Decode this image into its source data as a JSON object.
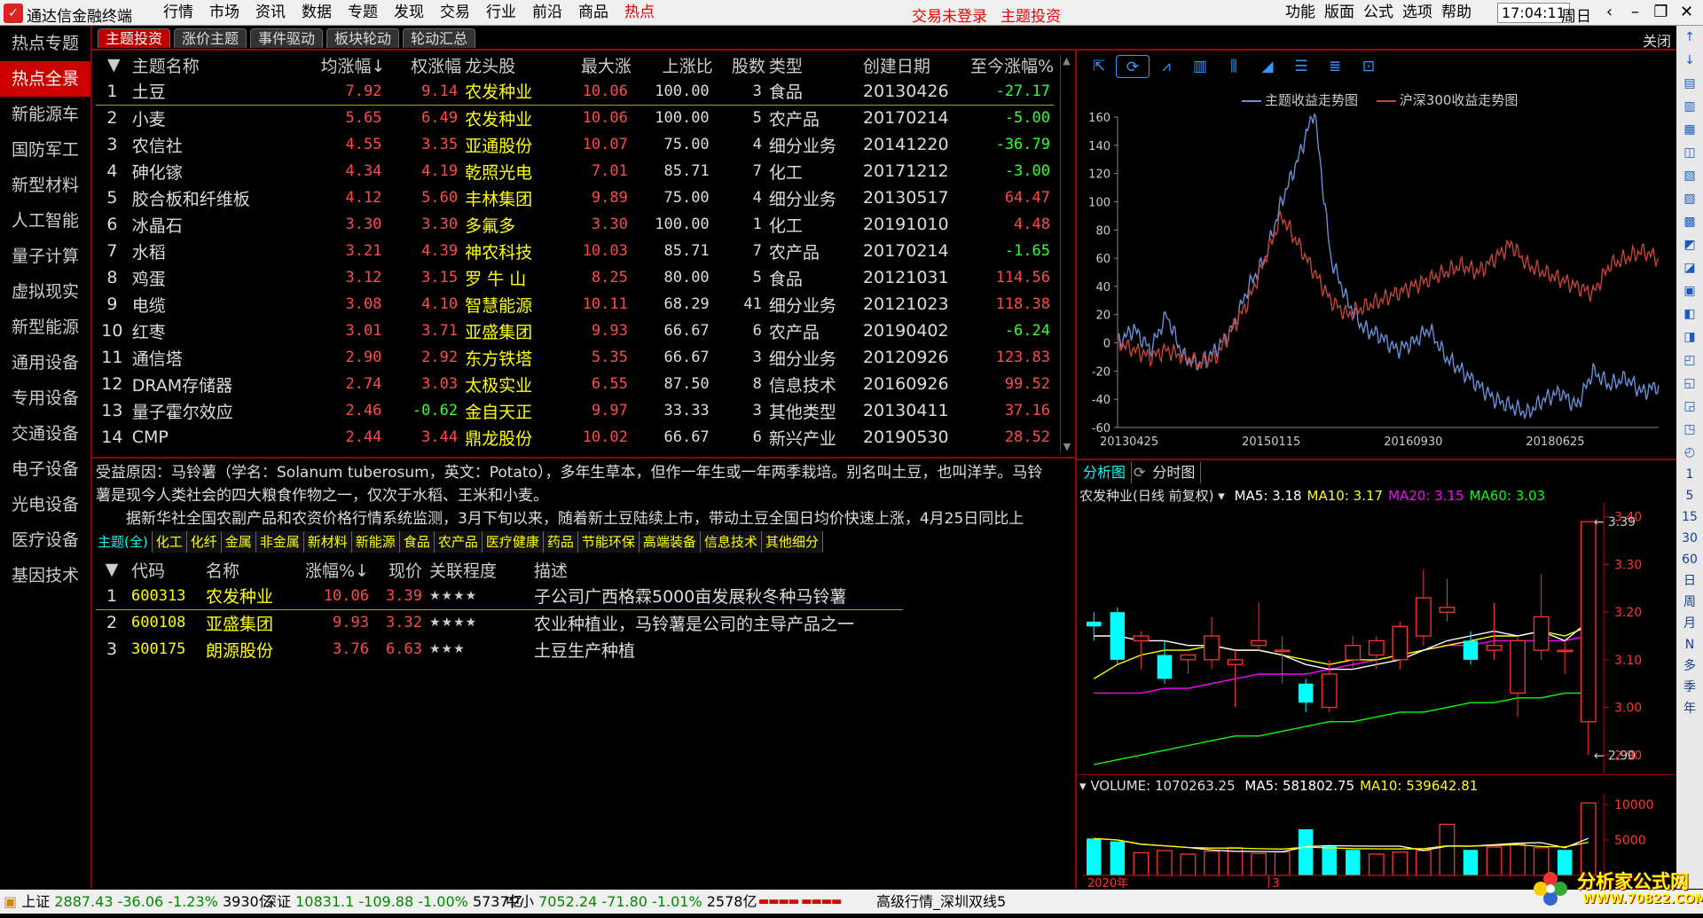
{
  "app": {
    "title": "通达信金融终端"
  },
  "menu": [
    "行情",
    "市场",
    "资讯",
    "数据",
    "专题",
    "发现",
    "交易",
    "行业",
    "前沿",
    "商品",
    "热点"
  ],
  "menu_active": 10,
  "alerts": {
    "trade": "交易未登录",
    "theme": "主题投资"
  },
  "right_menu": [
    "功能",
    "版面",
    "公式",
    "选项",
    "帮助"
  ],
  "clock": "17:04:11",
  "weekday": "周日",
  "sidebar": [
    "热点专题",
    "热点全景",
    "新能源车",
    "国防军工",
    "新型材料",
    "人工智能",
    "量子计算",
    "虚拟现实",
    "新型能源",
    "通用设备",
    "专用设备",
    "交通设备",
    "电子设备",
    "光电设备",
    "医疗设备",
    "基因技术"
  ],
  "sidebar_active": 1,
  "tabs": [
    "主题投资",
    "涨价主题",
    "事件驱动",
    "板块轮动",
    "轮动汇总"
  ],
  "close_label": "关闭",
  "theme_table": {
    "headers": [
      "主题名称",
      "均涨幅↓",
      "权涨幅",
      "龙头股",
      "最大涨",
      "上涨比",
      "股数",
      "类型",
      "创建日期",
      "至今涨幅%"
    ],
    "rows": [
      [
        "1",
        "土豆",
        "7.92",
        "9.14",
        "农发种业",
        "10.06",
        "100.00",
        "3",
        "食品",
        "20130426",
        "-27.17"
      ],
      [
        "2",
        "小麦",
        "5.65",
        "6.49",
        "农发种业",
        "10.06",
        "100.00",
        "5",
        "农产品",
        "20170214",
        "-5.00"
      ],
      [
        "3",
        "农信社",
        "4.55",
        "3.35",
        "亚通股份",
        "10.07",
        "75.00",
        "4",
        "细分业务",
        "20141220",
        "-36.79"
      ],
      [
        "4",
        "砷化镓",
        "4.34",
        "4.19",
        "乾照光电",
        "7.01",
        "85.71",
        "7",
        "化工",
        "20171212",
        "-3.00"
      ],
      [
        "5",
        "胶合板和纤维板",
        "4.12",
        "5.60",
        "丰林集团",
        "9.89",
        "75.00",
        "4",
        "细分业务",
        "20130517",
        "64.47"
      ],
      [
        "6",
        "冰晶石",
        "3.30",
        "3.30",
        "多氟多",
        "3.30",
        "100.00",
        "1",
        "化工",
        "20191010",
        "4.48"
      ],
      [
        "7",
        "水稻",
        "3.21",
        "4.39",
        "神农科技",
        "10.03",
        "85.71",
        "7",
        "农产品",
        "20170214",
        "-1.65"
      ],
      [
        "8",
        "鸡蛋",
        "3.12",
        "3.15",
        "罗 牛 山",
        "8.25",
        "80.00",
        "5",
        "食品",
        "20121031",
        "114.56"
      ],
      [
        "9",
        "电缆",
        "3.08",
        "4.10",
        "智慧能源",
        "10.11",
        "68.29",
        "41",
        "细分业务",
        "20121023",
        "118.38"
      ],
      [
        "10",
        "红枣",
        "3.01",
        "3.71",
        "亚盛集团",
        "9.93",
        "66.67",
        "6",
        "农产品",
        "20190402",
        "-6.24"
      ],
      [
        "11",
        "通信塔",
        "2.90",
        "2.92",
        "东方铁塔",
        "5.35",
        "66.67",
        "3",
        "细分业务",
        "20120926",
        "123.83"
      ],
      [
        "12",
        "DRAM存储器",
        "2.74",
        "3.03",
        "太极实业",
        "6.55",
        "87.50",
        "8",
        "信息技术",
        "20160926",
        "99.52"
      ],
      [
        "13",
        "量子霍尔效应",
        "2.46",
        "-0.62",
        "金自天正",
        "9.97",
        "33.33",
        "3",
        "其他类型",
        "20130411",
        "37.16"
      ],
      [
        "14",
        "CMP",
        "2.44",
        "3.44",
        "鼎龙股份",
        "10.02",
        "66.67",
        "6",
        "新兴产业",
        "20190530",
        "28.52"
      ]
    ]
  },
  "description": {
    "line1": "受益原因：马铃薯（学名：Solanum tuberosum，英文：Potato），多年生草本，但作一年生或一年两季栽培。别名叫土豆，也叫洋芋。马铃薯是现今人类社会的四大粮食作物之一，仅次于水稻、王米和小麦。",
    "line2": "据新华社全国农副产品和农资价格行情系统监测，3月下旬以来，随着新土豆陆续上市，带动土豆全国日均价快速上涨，4月25日同比上"
  },
  "category_tabs": [
    "主题(全)",
    "化工",
    "化纤",
    "金属",
    "非金属",
    "新材料",
    "新能源",
    "食品",
    "农产品",
    "医疗健康",
    "药品",
    "节能环保",
    "高端装备",
    "信息技术",
    "其他细分"
  ],
  "stock_table": {
    "headers": [
      "代码",
      "名称",
      "涨幅%↓",
      "现价",
      "关联程度",
      "描述"
    ],
    "rows": [
      [
        "1",
        "600313",
        "农发种业",
        "10.06",
        "3.39",
        "★★★★",
        "子公司广西格霖5000亩发展秋冬种马铃薯"
      ],
      [
        "2",
        "600108",
        "亚盛集团",
        "9.93",
        "3.32",
        "★★★★",
        "农业种植业，马铃薯是公司的主导产品之一"
      ],
      [
        "3",
        "300175",
        "朗源股份",
        "3.76",
        "6.63",
        "★★★",
        "土豆生产种植"
      ]
    ]
  },
  "chart_toolbar": [
    "cursor-icon",
    "refresh-icon",
    "line-chart-icon",
    "bar-chart-icon",
    "compare-icon",
    "area-chart-icon",
    "list-icon",
    "grid-list-icon",
    "export-icon"
  ],
  "chart_data": [
    {
      "type": "line",
      "legend": [
        "主题收益走势图",
        "沪深300收益走势图"
      ],
      "x_ticks": [
        "20130425",
        "20150115",
        "20160930",
        "20180625"
      ],
      "ylim": [
        -60,
        160
      ],
      "y_ticks": [
        160,
        140,
        120,
        100,
        80,
        60,
        40,
        20,
        0,
        -20,
        -40,
        -60
      ],
      "series": [
        {
          "name": "主题收益走势图",
          "color": "#6b8fd6",
          "values": [
            0,
            10,
            -5,
            20,
            -10,
            -15,
            -5,
            10,
            40,
            60,
            100,
            130,
            165,
            60,
            30,
            10,
            5,
            -5,
            0,
            10,
            -10,
            -20,
            -30,
            -40,
            -45,
            -50,
            -40,
            -35,
            -45,
            -20,
            -30,
            -25,
            -35,
            -30
          ]
        },
        {
          "name": "沪深300收益走势图",
          "color": "#c0453a",
          "values": [
            0,
            -5,
            -10,
            -5,
            -10,
            -15,
            -10,
            10,
            30,
            60,
            90,
            70,
            50,
            30,
            20,
            25,
            30,
            35,
            40,
            45,
            50,
            55,
            50,
            60,
            70,
            55,
            50,
            45,
            40,
            35,
            55,
            60,
            65,
            60
          ]
        }
      ]
    },
    {
      "type": "candlestick",
      "title": "农发种业(日线 前复权)",
      "ma": [
        {
          "label": "MA5: 3.18",
          "color": "#ffffff"
        },
        {
          "label": "MA10: 3.17",
          "color": "#ffff00"
        },
        {
          "label": "MA20: 3.15",
          "color": "#ff00ff"
        },
        {
          "label": "MA60: 3.03",
          "color": "#00ff00"
        }
      ],
      "ylim": [
        2.88,
        3.42
      ],
      "y_ticks": [
        "3.40",
        "3.30",
        "3.20",
        "3.10",
        "3.00",
        "2.90"
      ],
      "annotations": {
        "high": "3.39",
        "low": "2.90"
      },
      "candles": [
        {
          "o": 3.18,
          "h": 3.2,
          "l": 3.14,
          "c": 3.17
        },
        {
          "o": 3.2,
          "h": 3.21,
          "l": 3.09,
          "c": 3.1
        },
        {
          "o": 3.14,
          "h": 3.16,
          "l": 3.08,
          "c": 3.15
        },
        {
          "o": 3.11,
          "h": 3.14,
          "l": 3.05,
          "c": 3.06
        },
        {
          "o": 3.1,
          "h": 3.11,
          "l": 3.07,
          "c": 3.11
        },
        {
          "o": 3.1,
          "h": 3.19,
          "l": 3.08,
          "c": 3.15
        },
        {
          "o": 3.09,
          "h": 3.12,
          "l": 3.0,
          "c": 3.1
        },
        {
          "o": 3.13,
          "h": 3.22,
          "l": 3.12,
          "c": 3.14
        },
        {
          "o": 3.12,
          "h": 3.15,
          "l": 3.05,
          "c": 3.12
        },
        {
          "o": 3.05,
          "h": 3.06,
          "l": 2.99,
          "c": 3.01
        },
        {
          "o": 3.0,
          "h": 3.1,
          "l": 2.99,
          "c": 3.07
        },
        {
          "o": 3.1,
          "h": 3.15,
          "l": 3.08,
          "c": 3.13
        },
        {
          "o": 3.11,
          "h": 3.15,
          "l": 3.08,
          "c": 3.14
        },
        {
          "o": 3.1,
          "h": 3.18,
          "l": 3.08,
          "c": 3.17
        },
        {
          "o": 3.15,
          "h": 3.29,
          "l": 3.13,
          "c": 3.23
        },
        {
          "o": 3.2,
          "h": 3.27,
          "l": 3.18,
          "c": 3.21
        },
        {
          "o": 3.14,
          "h": 3.16,
          "l": 3.09,
          "c": 3.1
        },
        {
          "o": 3.12,
          "h": 3.22,
          "l": 3.1,
          "c": 3.13
        },
        {
          "o": 3.03,
          "h": 3.15,
          "l": 2.98,
          "c": 3.14
        },
        {
          "o": 3.12,
          "h": 3.28,
          "l": 3.1,
          "c": 3.19
        },
        {
          "o": 3.12,
          "h": 3.14,
          "l": 3.07,
          "c": 3.12
        },
        {
          "o": 2.97,
          "h": 3.39,
          "l": 2.9,
          "c": 3.39
        }
      ],
      "ma5": [
        3.15,
        3.15,
        3.14,
        3.14,
        3.13,
        3.13,
        3.12,
        3.12,
        3.11,
        3.09,
        3.08,
        3.08,
        3.09,
        3.1,
        3.12,
        3.14,
        3.15,
        3.16,
        3.15,
        3.16,
        3.14,
        3.18
      ],
      "ma10": [
        3.06,
        3.09,
        3.11,
        3.12,
        3.12,
        3.13,
        3.12,
        3.12,
        3.11,
        3.1,
        3.09,
        3.1,
        3.1,
        3.11,
        3.12,
        3.13,
        3.14,
        3.15,
        3.15,
        3.16,
        3.15,
        3.17
      ],
      "ma20": [
        3.03,
        3.03,
        3.03,
        3.04,
        3.04,
        3.05,
        3.06,
        3.07,
        3.07,
        3.07,
        3.08,
        3.09,
        3.1,
        3.11,
        3.12,
        3.13,
        3.13,
        3.14,
        3.14,
        3.14,
        3.14,
        3.15
      ],
      "ma60": [
        2.88,
        2.89,
        2.9,
        2.91,
        2.92,
        2.93,
        2.94,
        2.94,
        2.95,
        2.96,
        2.97,
        2.97,
        2.98,
        2.99,
        2.99,
        3.0,
        3.01,
        3.01,
        3.02,
        3.02,
        3.03,
        3.03
      ]
    },
    {
      "type": "bar",
      "title": "VOLUME: 1070263.25",
      "ma": [
        {
          "label": "MA5: 581802.75",
          "color": "#ffffff"
        },
        {
          "label": "MA10: 539642.81",
          "color": "#ffff00"
        }
      ],
      "y_ticks": [
        "10000",
        "5000"
      ],
      "x_labels": [
        "2020年",
        "3"
      ],
      "values": [
        5200,
        4800,
        3200,
        3500,
        3000,
        3400,
        3900,
        3100,
        3300,
        6500,
        4200,
        3600,
        3000,
        3300,
        3500,
        7200,
        3600,
        4000,
        4400,
        3900,
        3600,
        10200
      ],
      "colors": [
        "#0ff",
        "#0ff",
        "#f33",
        "#f33",
        "#f33",
        "#f33",
        "#f33",
        "#f33",
        "#f33",
        "#0ff",
        "#0ff",
        "#0ff",
        "#f33",
        "#f33",
        "#f33",
        "#f33",
        "#0ff",
        "#f33",
        "#f33",
        "#f33",
        "#0ff",
        "#f33"
      ],
      "ylim": [
        0,
        11000
      ]
    }
  ],
  "panel_tabs": [
    "分析图",
    "分时图"
  ],
  "right_tools": [
    "↑",
    "↓",
    "▤",
    "▥",
    "▦",
    "◫",
    "▧",
    "▨",
    "▩",
    "◩",
    "◪",
    "▣",
    "◧",
    "◨",
    "◰",
    "◱",
    "◲",
    "◳",
    "◴"
  ],
  "right_tools_text": [
    "1",
    "5",
    "15",
    "30",
    "60",
    "日",
    "周",
    "月",
    "N",
    "多",
    "季",
    "年"
  ],
  "statusbar": {
    "sh": {
      "name": "上证",
      "price": "2887.43",
      "chg": "-36.06",
      "pct": "-1.23%",
      "amt": "3930亿"
    },
    "sz": {
      "name": "深证",
      "price": "10831.1",
      "chg": "-109.88",
      "pct": "-1.00%",
      "amt": "5737亿"
    },
    "zx": {
      "name": "中小",
      "price": "7052.24",
      "chg": "-71.80",
      "pct": "-1.01%",
      "amt": "2578亿"
    },
    "feed": "高级行情_深圳双线5"
  },
  "watermark": {
    "line1": "分析家公式网",
    "line2": "WWW.70822.COM"
  }
}
